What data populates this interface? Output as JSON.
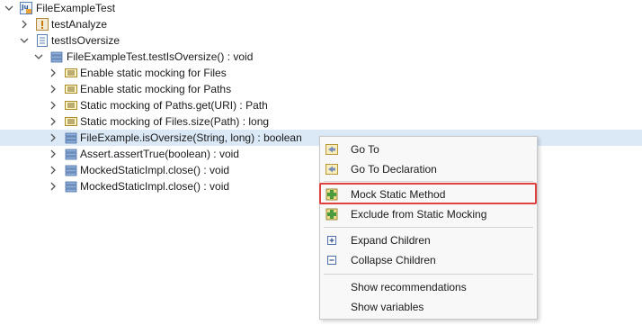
{
  "tree": {
    "root": "FileExampleTest",
    "test_analyze": "testAnalyze",
    "test_is_oversize": "testIsOversize",
    "method": "FileExampleTest.testIsOversize() : void",
    "children": [
      "Enable static mocking for Files",
      "Enable static mocking for Paths",
      "Static mocking of Paths.get(URI) : Path",
      "Static mocking of Files.size(Path) : long",
      "FileExample.isOversize(String, long) : boolean",
      "Assert.assertTrue(boolean) : void",
      "MockedStaticImpl.close() : void",
      "MockedStaticImpl.close() : void"
    ]
  },
  "context_menu": {
    "go_to": "Go To",
    "go_to_declaration": "Go To Declaration",
    "mock_static_method": "Mock Static Method",
    "exclude_static": "Exclude from Static Mocking",
    "expand_children": "Expand Children",
    "collapse_children": "Collapse Children",
    "show_recommendations": "Show recommendations",
    "show_variables": "Show variables"
  },
  "colors": {
    "selection": "#dbe9f7",
    "highlight_border": "#e04040"
  }
}
